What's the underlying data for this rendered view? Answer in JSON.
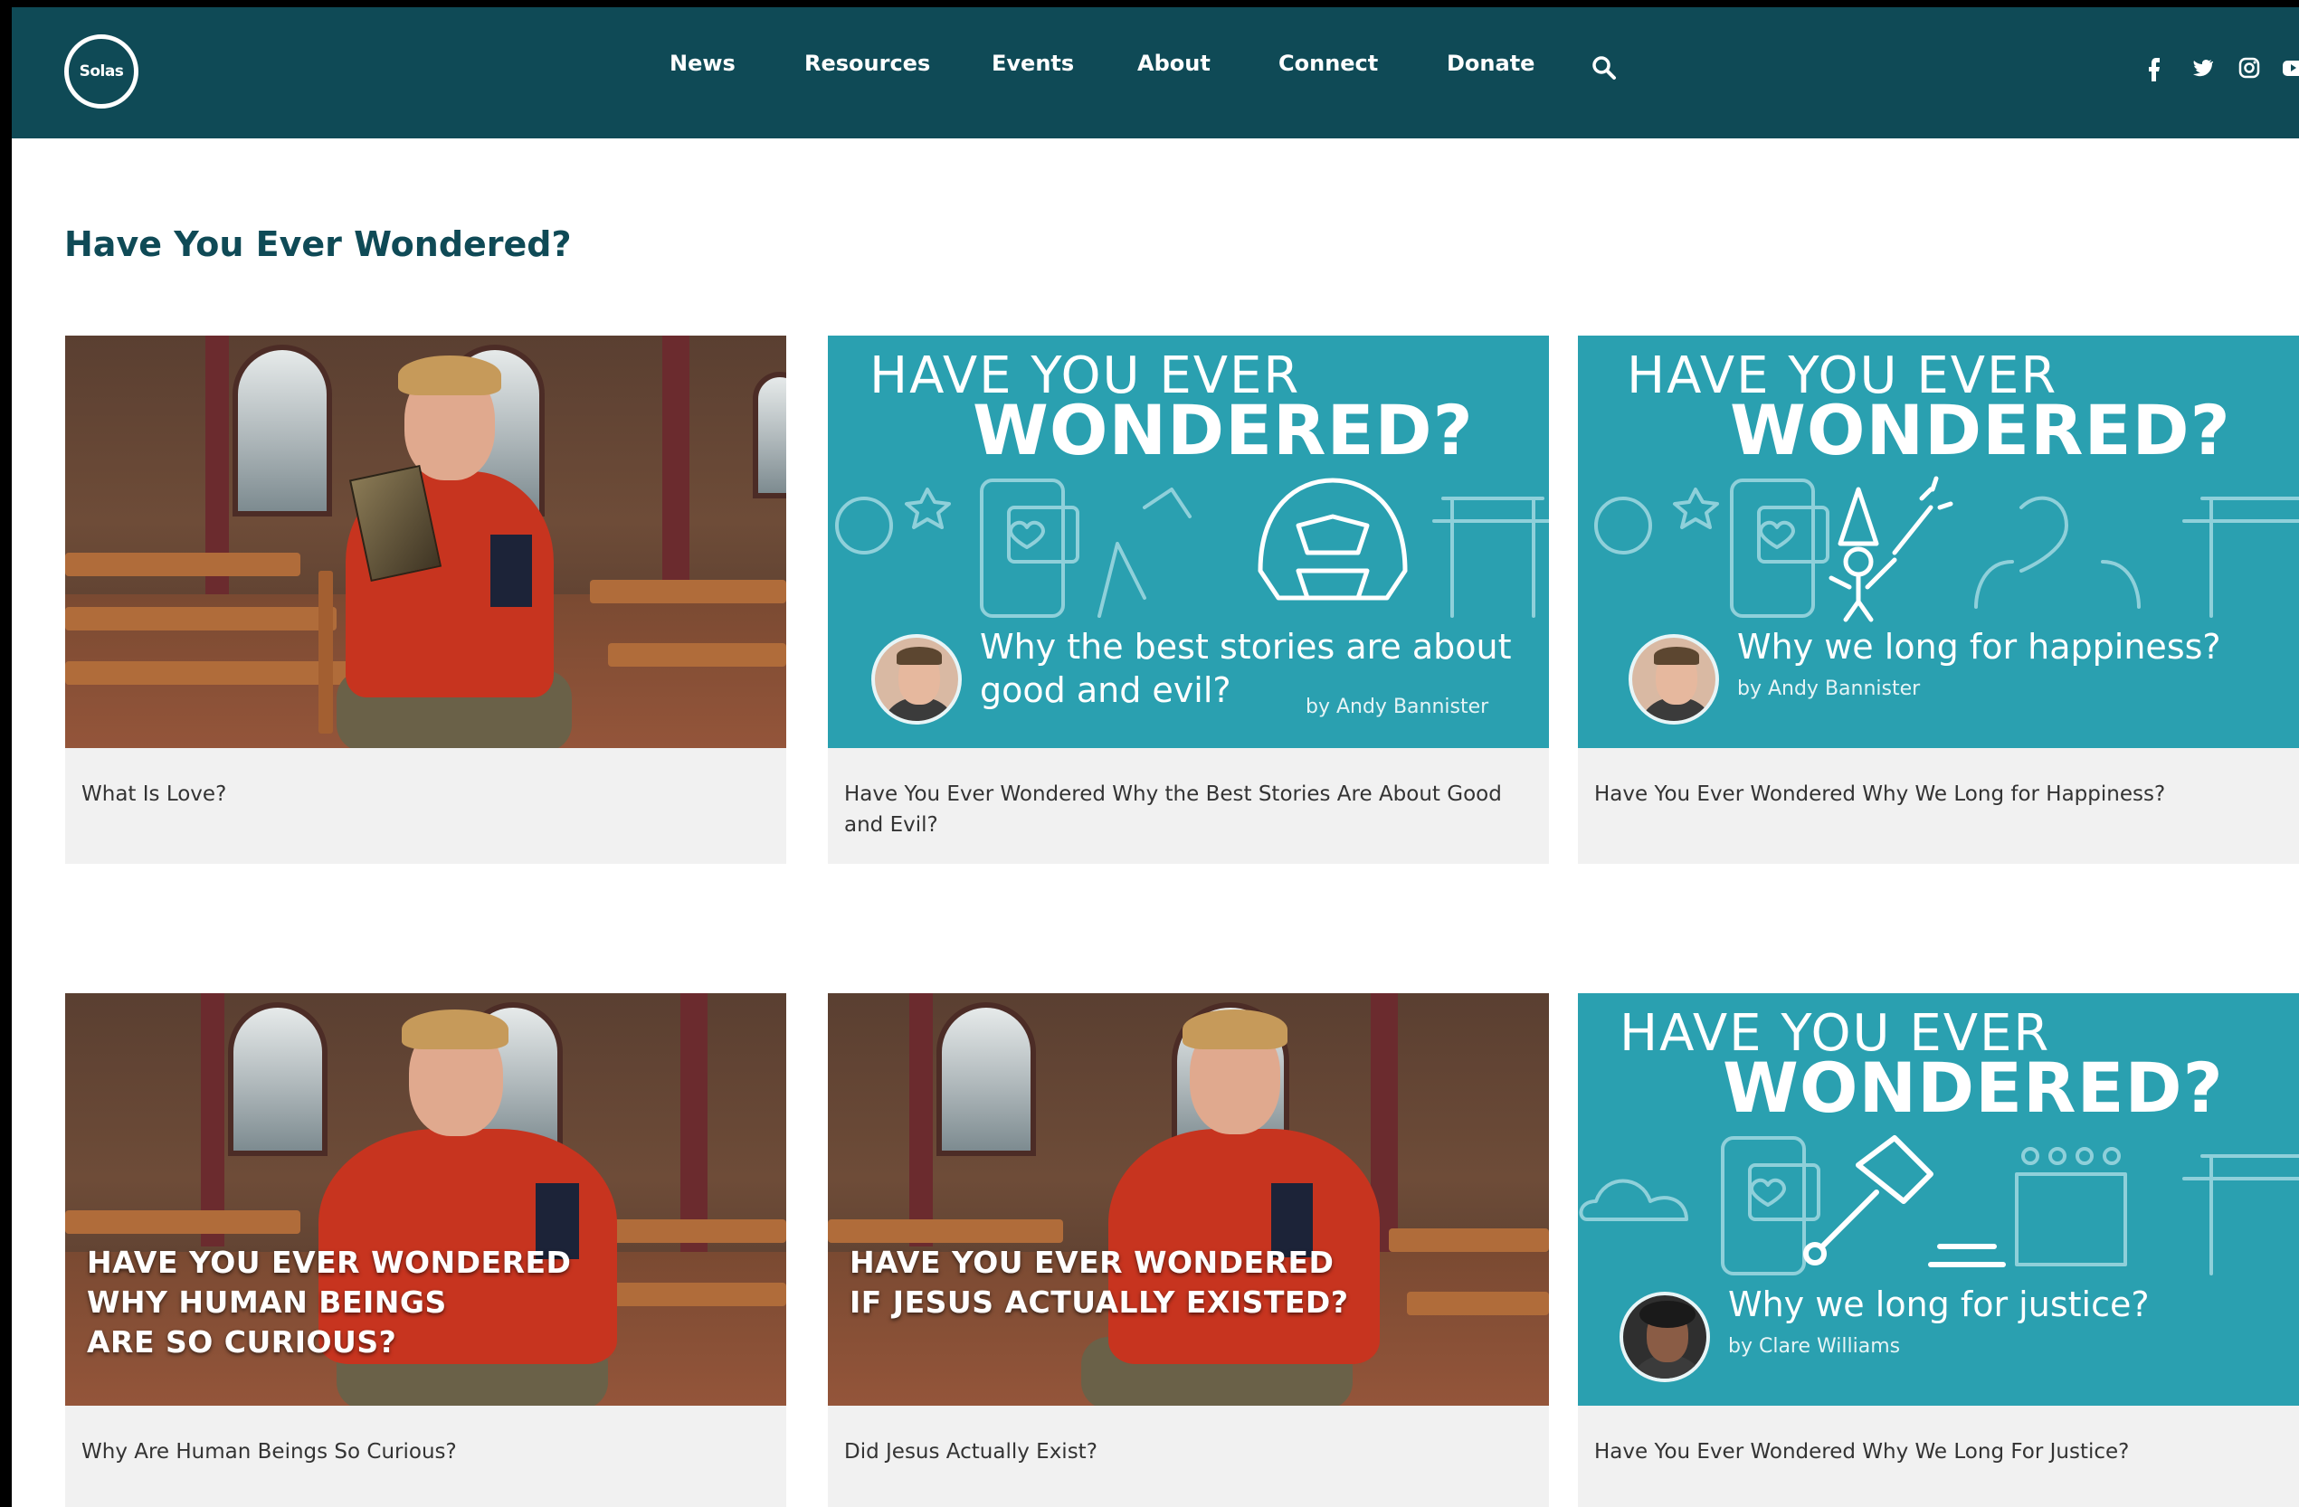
{
  "header": {
    "logo_text": "Solas",
    "nav": [
      "News",
      "Resources",
      "Events",
      "About",
      "Connect",
      "Donate"
    ],
    "social": [
      "f",
      "t",
      "ig",
      "yt"
    ]
  },
  "page_title": "Have You Ever Wondered?",
  "cards": [
    {
      "caption": "What Is Love?"
    },
    {
      "caption": "Have You Ever Wondered Why the Best Stories Are About Good and Evil?",
      "promo": {
        "line1": "HAVE YOU EVER",
        "line2": "WONDERED?",
        "sub1": "Why the best stories are about",
        "sub2": "good and evil?",
        "by": "by Andy Bannister"
      }
    },
    {
      "caption": "Have You Ever Wondered Why We Long for Happiness?",
      "promo": {
        "line1": "HAVE YOU EVER",
        "line2": "WONDERED?",
        "sub1": "Why we long for happiness?",
        "by": "by Andy Bannister"
      }
    },
    {
      "caption": "Why Are Human Beings So Curious?",
      "overlay": [
        "HAVE YOU EVER WONDERED",
        "WHY HUMAN BEINGS",
        "ARE SO CURIOUS?"
      ]
    },
    {
      "caption": "Did Jesus Actually Exist?",
      "overlay": [
        "HAVE YOU EVER WONDERED",
        "IF JESUS ACTUALLY EXISTED?"
      ]
    },
    {
      "caption": "Have You Ever Wondered Why We Long For Justice?",
      "promo": {
        "line1": "HAVE YOU EVER",
        "line2": "WONDERED?",
        "sub1": "Why we long for justice?",
        "by": "by Clare Williams"
      }
    }
  ]
}
